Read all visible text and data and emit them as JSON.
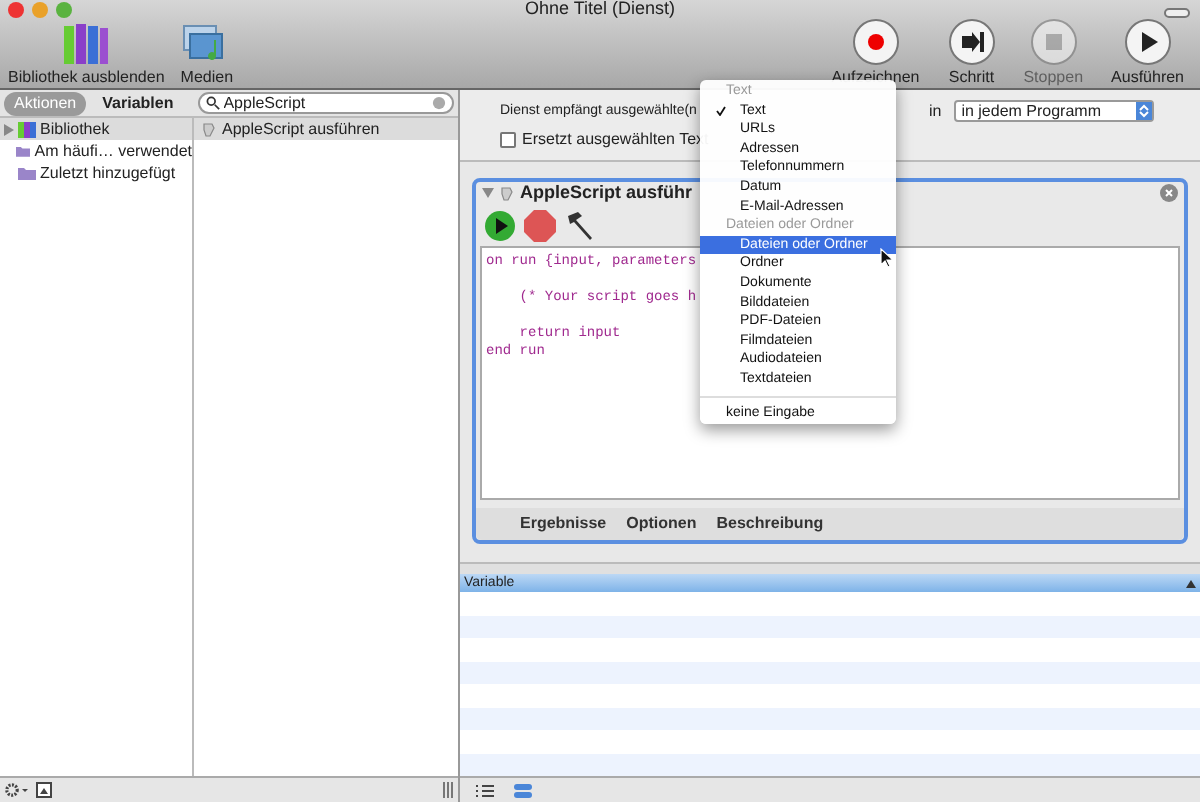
{
  "window": {
    "title": "Ohne Titel (Dienst)"
  },
  "toolbar_left": [
    {
      "kind": "library",
      "label": "Bibliothek ausblenden"
    },
    {
      "kind": "media",
      "label": "Medien"
    }
  ],
  "toolbar_right": [
    {
      "kind": "record",
      "label": "Aufzeichnen",
      "disabled": false
    },
    {
      "kind": "step",
      "label": "Schritt",
      "disabled": false
    },
    {
      "kind": "stop",
      "label": "Stoppen",
      "disabled": true
    },
    {
      "kind": "run",
      "label": "Ausführen",
      "disabled": false
    }
  ],
  "sidebar": {
    "tabs": [
      {
        "label": "Aktionen",
        "selected": true
      },
      {
        "label": "Variablen",
        "selected": false
      }
    ],
    "search": {
      "value": "AppleScript"
    },
    "items": [
      {
        "kind": "library",
        "label": "Bibliothek",
        "selected": true
      },
      {
        "kind": "folder",
        "label": "Am häufi… verwendet",
        "selected": false
      },
      {
        "kind": "folder",
        "label": "Zuletzt hinzugefügt",
        "selected": false
      }
    ]
  },
  "actions": [
    {
      "label": "AppleScript ausführen",
      "selected": true
    }
  ],
  "service": {
    "label": "Dienst empfängt ausgewählte(n",
    "in_label": "in",
    "program": "in jedem Programm",
    "replace": {
      "label": "Ersetzt ausgewählten Text",
      "checked": false
    }
  },
  "action_card": {
    "title": "AppleScript ausführ",
    "code": "on run {input, parameters\n\n    (* Your script goes h\n\n    return input\nend run",
    "tabs": [
      "Ergebnisse",
      "Optionen",
      "Beschreibung"
    ]
  },
  "variables": {
    "column": "Variable"
  },
  "menu": [
    {
      "kind": "header",
      "label": "Text"
    },
    {
      "kind": "item",
      "label": "Text",
      "checked": true,
      "selected": false
    },
    {
      "kind": "item",
      "label": "URLs",
      "checked": false,
      "selected": false
    },
    {
      "kind": "item",
      "label": "Adressen",
      "checked": false,
      "selected": false
    },
    {
      "kind": "item",
      "label": "Telefonnummern",
      "checked": false,
      "selected": false
    },
    {
      "kind": "item",
      "label": "Datum",
      "checked": false,
      "selected": false
    },
    {
      "kind": "item",
      "label": "E-Mail-Adressen",
      "checked": false,
      "selected": false
    },
    {
      "kind": "header",
      "label": "Dateien oder Ordner"
    },
    {
      "kind": "item",
      "label": "Dateien oder Ordner",
      "checked": false,
      "selected": true
    },
    {
      "kind": "item",
      "label": "Ordner",
      "checked": false,
      "selected": false
    },
    {
      "kind": "item",
      "label": "Dokumente",
      "checked": false,
      "selected": false
    },
    {
      "kind": "item",
      "label": "Bilddateien",
      "checked": false,
      "selected": false
    },
    {
      "kind": "item",
      "label": "PDF-Dateien",
      "checked": false,
      "selected": false
    },
    {
      "kind": "item",
      "label": "Filmdateien",
      "checked": false,
      "selected": false
    },
    {
      "kind": "item",
      "label": "Audiodateien",
      "checked": false,
      "selected": false
    },
    {
      "kind": "item",
      "label": "Textdateien",
      "checked": false,
      "selected": false
    },
    {
      "kind": "separator"
    },
    {
      "kind": "header_item",
      "label": "keine Eingabe",
      "checked": false,
      "selected": false
    }
  ]
}
